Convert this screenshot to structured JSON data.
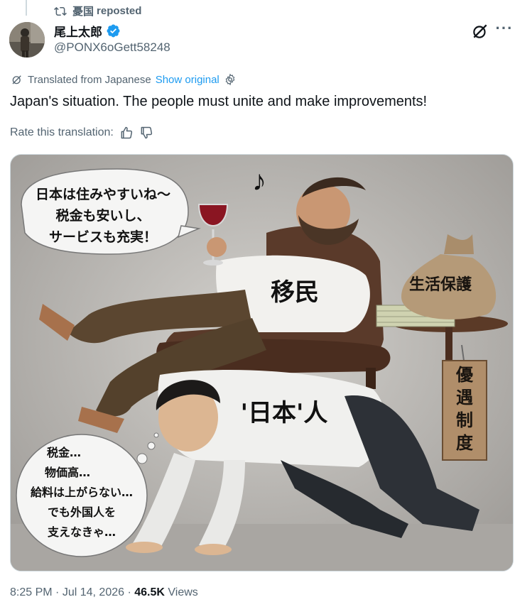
{
  "repost": {
    "user": "憂国",
    "label": "reposted"
  },
  "author": {
    "name": "尾上太郎",
    "handle": "@PONX6oGett58248"
  },
  "translation": {
    "label": "Translated from Japanese",
    "show_original": "Show original"
  },
  "tweet": {
    "text": "Japan's situation. The people must unite and make improvements!"
  },
  "rate": {
    "label": "Rate this translation:"
  },
  "illustration": {
    "speech_lines": [
      "日本は住みやすいね〜",
      "税金も安いし、",
      "サービスも充実！"
    ],
    "shirt_label": "移民",
    "bag_label": "生活保護",
    "tag_label": [
      "優",
      "遇",
      "制",
      "度"
    ],
    "back_label": "'日本'人",
    "thought_lines": [
      "税金…",
      "物価高…",
      "給料は上がらない…",
      "でも外国人を",
      "支えなきゃ…"
    ],
    "note_glyph": "♪"
  },
  "meta": {
    "time": "8:25 PM",
    "date": "Jul 14, 2026",
    "views_count": "46.5K",
    "views_label": "Views",
    "sep": "·"
  },
  "colors": {
    "link": "#1d9bf0",
    "muted": "#536471",
    "text": "#0f1419"
  }
}
